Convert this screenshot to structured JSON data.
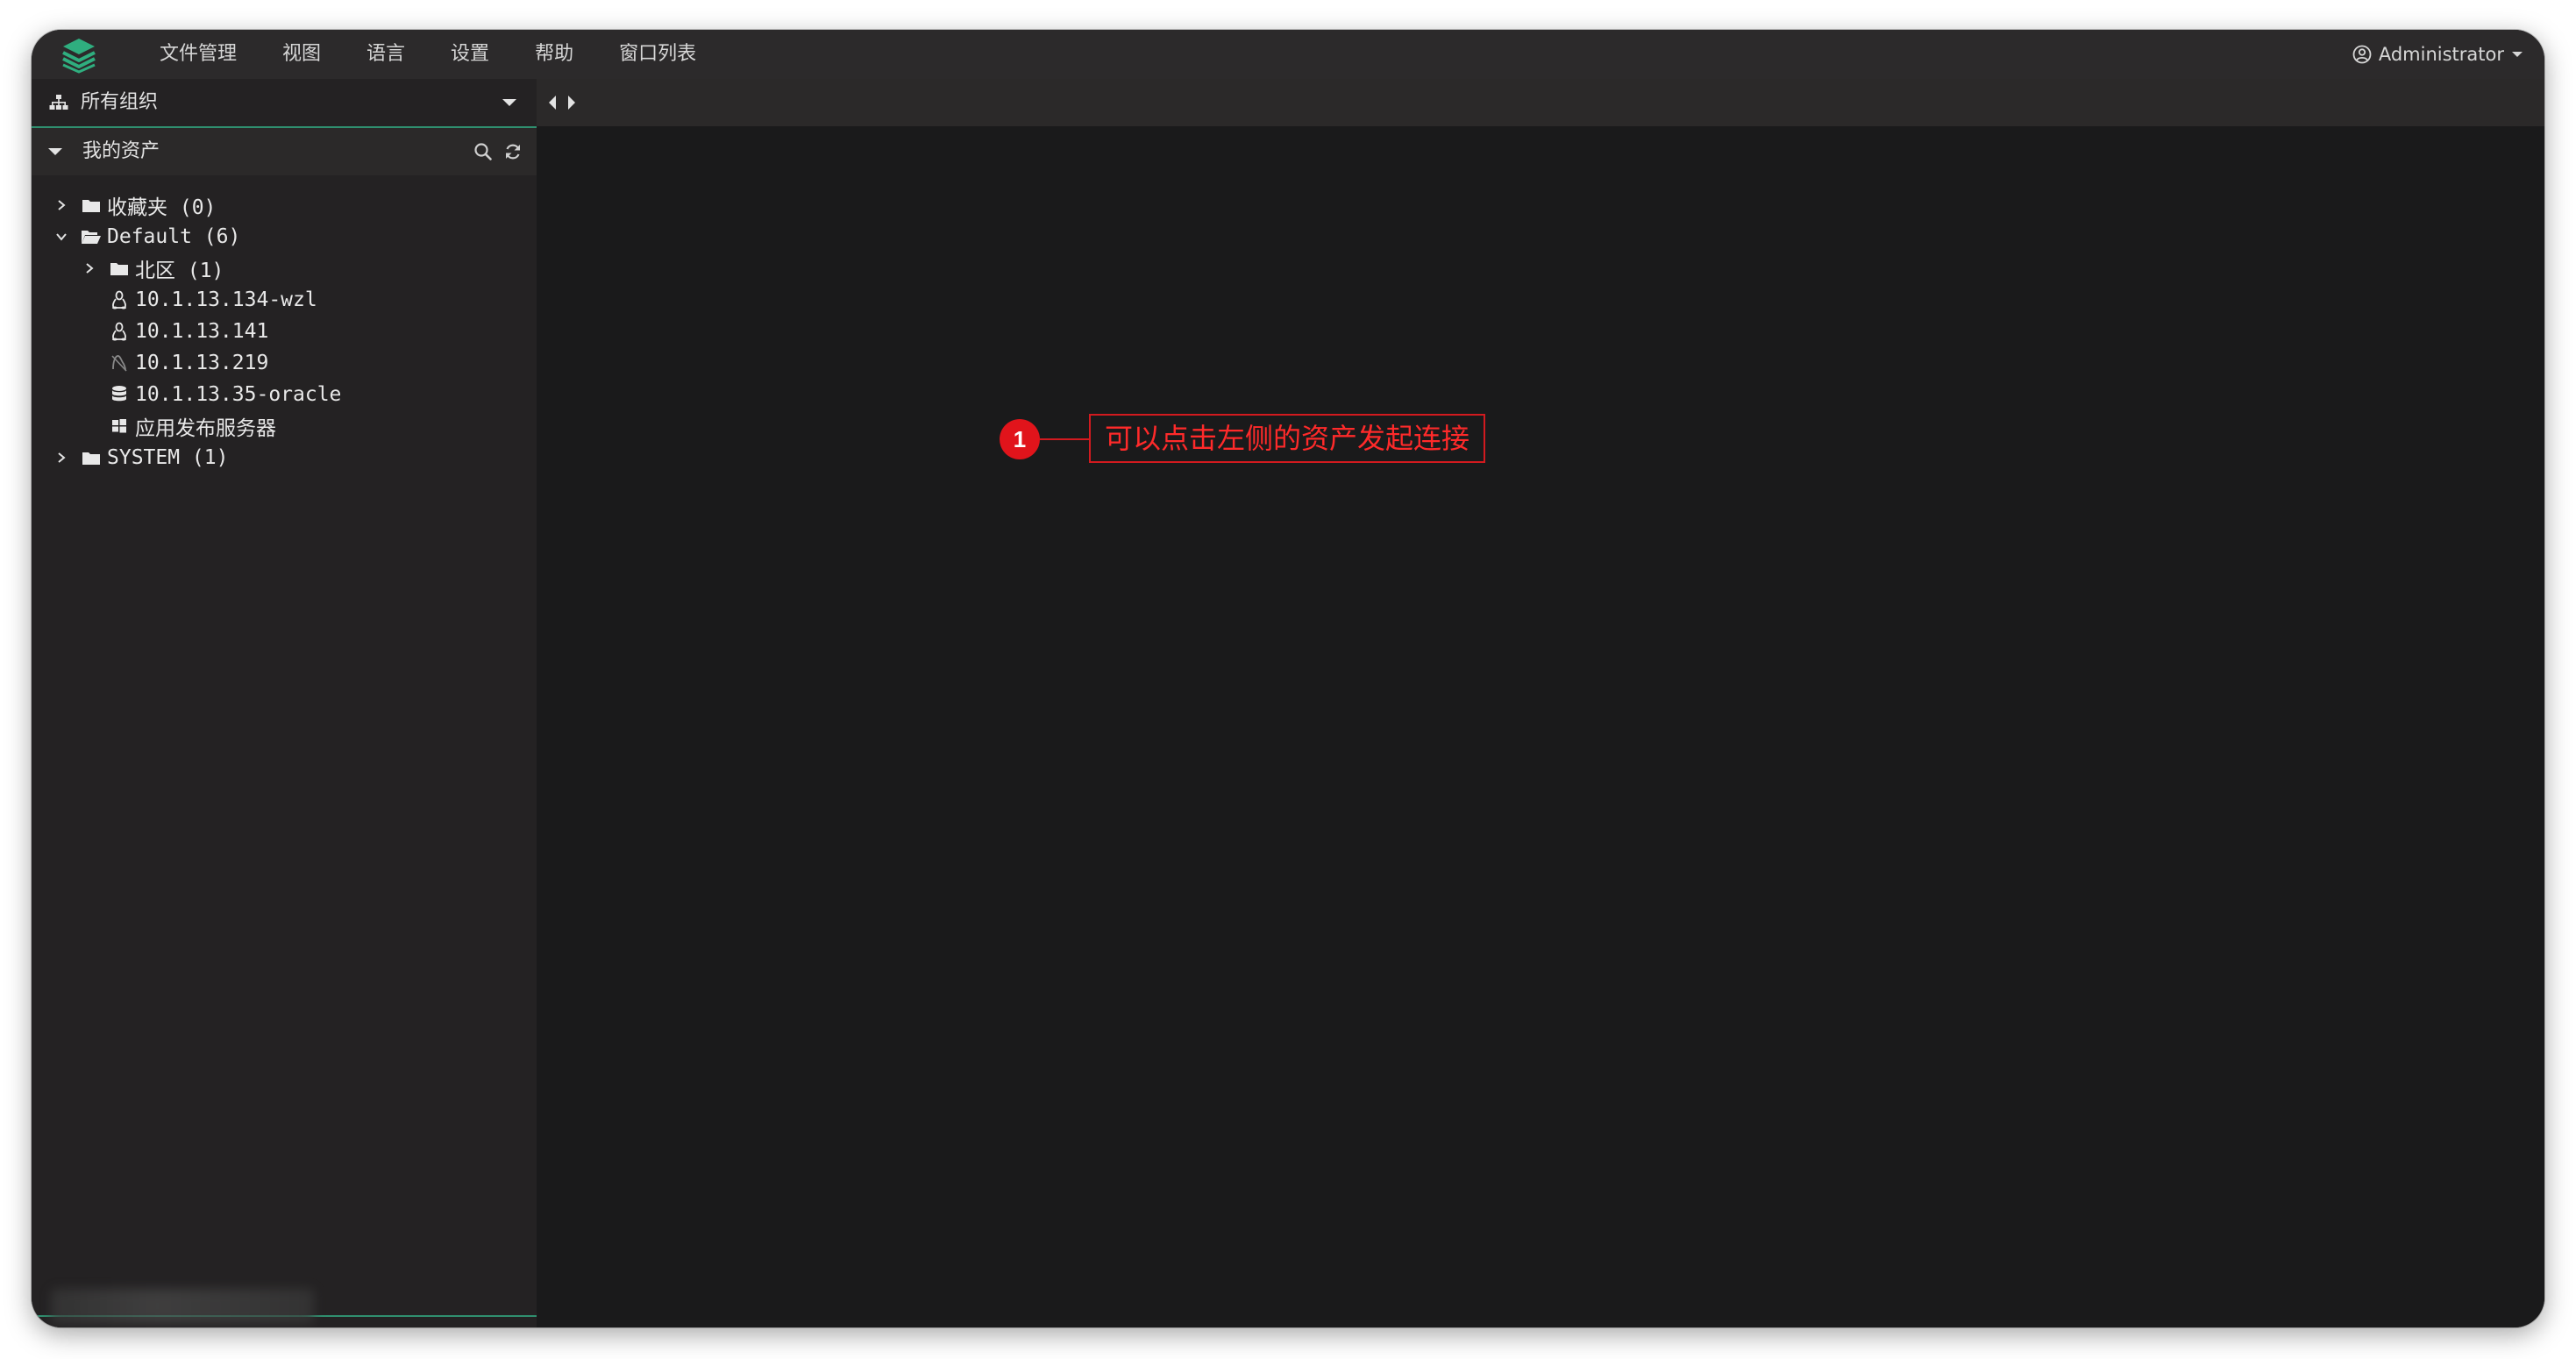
{
  "menubar": {
    "items": [
      "文件管理",
      "视图",
      "语言",
      "设置",
      "帮助",
      "窗口列表"
    ],
    "user": "Administrator"
  },
  "sidebar": {
    "org_selector": "所有组织",
    "assets_title": "我的资产",
    "tree": [
      {
        "label": "收藏夹 (0)",
        "expanded": false,
        "icon": "folder-icon"
      },
      {
        "label": "Default (6)",
        "expanded": true,
        "icon": "folder-open-icon"
      },
      {
        "label": "北区 (1)",
        "expanded": false,
        "icon": "folder-icon"
      },
      {
        "label": "10.1.13.134-wzl",
        "icon": "linux-icon"
      },
      {
        "label": "10.1.13.141",
        "icon": "linux-icon"
      },
      {
        "label": "10.1.13.219",
        "icon": "asset-disabled-icon"
      },
      {
        "label": "10.1.13.35-oracle",
        "icon": "database-icon"
      },
      {
        "label": "应用发布服务器",
        "icon": "windows-icon"
      },
      {
        "label": "SYSTEM (1)",
        "expanded": false,
        "icon": "folder-icon"
      }
    ]
  },
  "annotation": {
    "number": "1",
    "text": "可以点击左侧的资产发起连接"
  },
  "colors": {
    "accent": "#2f8f6f",
    "callout": "#e1141b",
    "background": "#1a1a1b",
    "sidebar": "#242223"
  }
}
